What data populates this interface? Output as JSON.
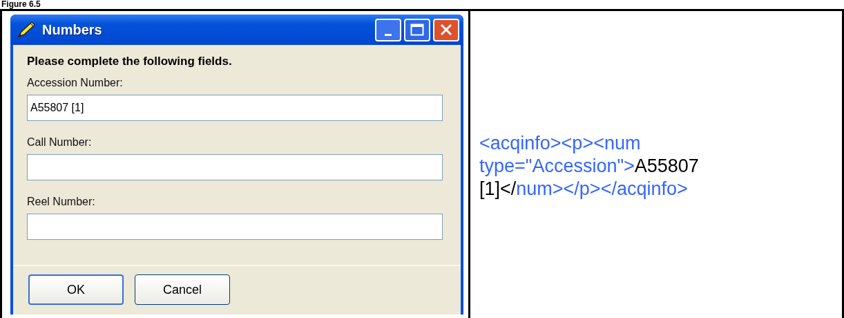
{
  "figure_title": "Figure 6.5",
  "dialog": {
    "title": "Numbers",
    "instruction": "Please complete the following fields.",
    "fields": [
      {
        "label": "Accession Number:",
        "value": "A55807 [1]"
      },
      {
        "label": "Call Number:"
      },
      {
        "label": "Reel Number:"
      }
    ],
    "buttons": [
      {
        "label": "OK",
        "kind": "default"
      },
      {
        "label": "Cancel",
        "kind": "normal"
      }
    ]
  },
  "xml_code": [
    {
      "kind": "tag",
      "text": "<acqinfo><p><num type=\"Accession\">"
    },
    {
      "kind": "text",
      "text": "A55807 [1]</"
    },
    {
      "kind": "tag",
      "text": "num></p></acqinfo>"
    }
  ]
}
